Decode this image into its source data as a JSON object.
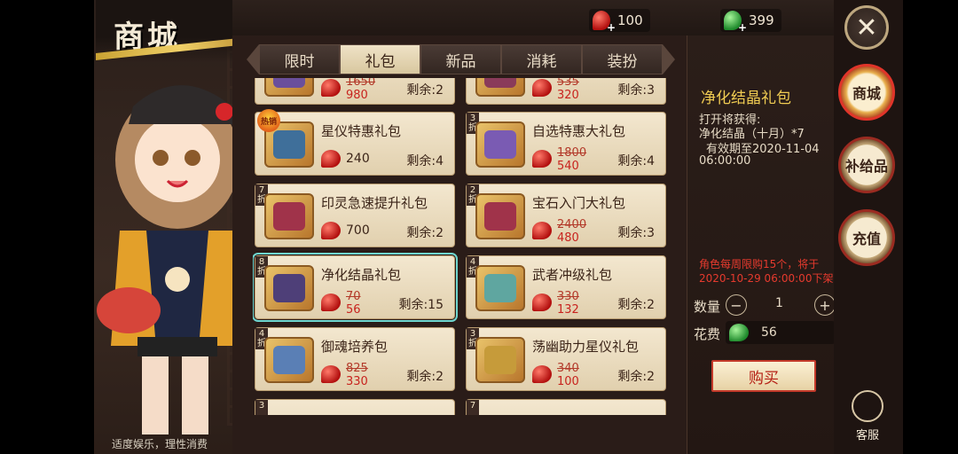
{
  "title": "商城",
  "currency": {
    "red_amount": "100",
    "green_amount": "399"
  },
  "tabs": [
    "限时",
    "礼包",
    "新品",
    "消耗",
    "装扮"
  ],
  "active_tab": 1,
  "items": [
    {
      "name": "",
      "old": "1650",
      "new": "980",
      "remain": "剩余:2",
      "badge": ""
    },
    {
      "name": "",
      "old": "535",
      "new": "320",
      "remain": "剩余:3",
      "badge": ""
    },
    {
      "name": "星仪特惠礼包",
      "price": "240",
      "remain": "剩余:4",
      "badge": "热销"
    },
    {
      "name": "自选特惠大礼包",
      "old": "1800",
      "new": "540",
      "remain": "剩余:4",
      "badge": "3 折"
    },
    {
      "name": "印灵急速提升礼包",
      "price": "700",
      "remain": "剩余:2",
      "badge": "7 折"
    },
    {
      "name": "宝石入门大礼包",
      "old": "2400",
      "new": "480",
      "remain": "剩余:3",
      "badge": "2 折"
    },
    {
      "name": "净化结晶礼包",
      "old": "70",
      "new": "56",
      "remain": "剩余:15",
      "badge": "8 折"
    },
    {
      "name": "武者冲级礼包",
      "old": "330",
      "new": "132",
      "remain": "剩余:2",
      "badge": "4 折"
    },
    {
      "name": "御魂培养包",
      "old": "825",
      "new": "330",
      "remain": "剩余:2",
      "badge": "4 折"
    },
    {
      "name": "荡幽助力星仪礼包",
      "old": "340",
      "new": "100",
      "remain": "剩余:2",
      "badge": "3 折"
    },
    {
      "name": "",
      "badge": "3"
    },
    {
      "name": "",
      "badge": "7"
    }
  ],
  "detail": {
    "title": "净化结晶礼包",
    "line1": "打开将获得:",
    "line2": "净化结晶（十月）*7",
    "line3": "有效期至2020-11-04",
    "line4": "06:00:00",
    "limit": "角色每周限购15个，将于2020-10-29 06:00:00下架",
    "qty_label": "数量",
    "qty_value": "1",
    "minus": "−",
    "plus": "+",
    "cost_label": "花费",
    "cost_value": "56",
    "buy": "购买"
  },
  "nav": {
    "close": "✕",
    "shop": "商城",
    "supply": "补给品",
    "recharge": "充值",
    "service": "客服"
  },
  "disclaimer": "适度娱乐，理性消费",
  "colors": {
    "accent_gold": "#f0cc52",
    "price_red": "#c8231e",
    "selected_outline": "#6fd6cf"
  }
}
